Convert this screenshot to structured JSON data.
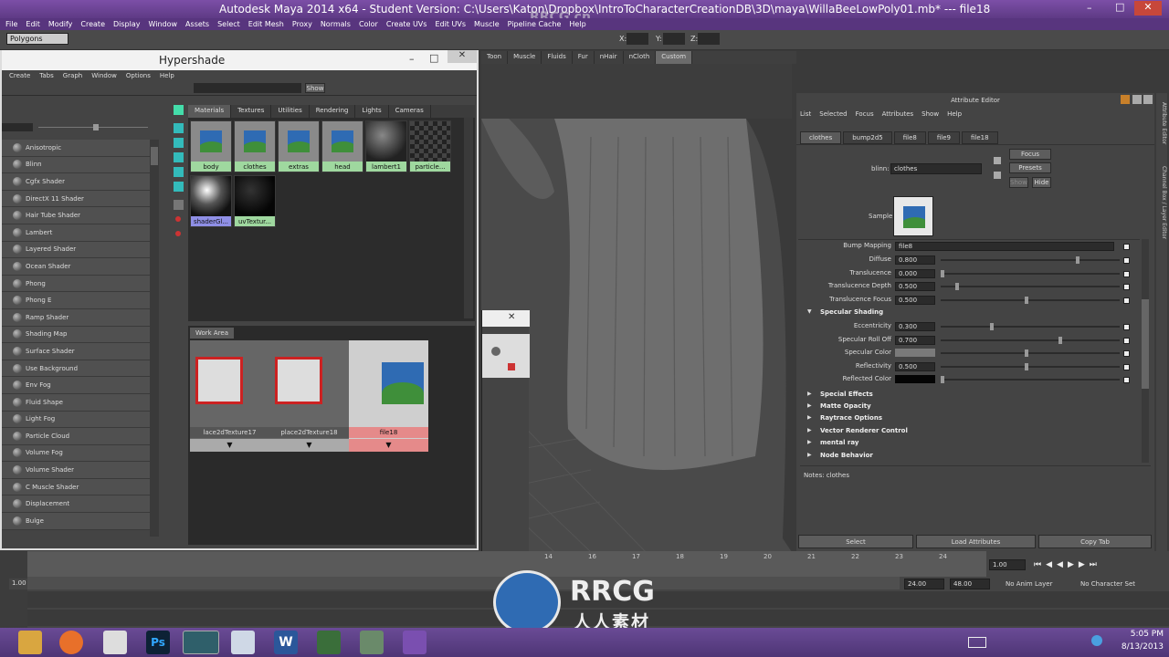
{
  "window": {
    "title": "Autodesk Maya 2014 x64 - Student Version: C:\\Users\\Katon\\Dropbox\\IntroToCharacterCreationDB\\3D\\maya\\WillaBeeLowPoly01.mb* --- file18"
  },
  "menubar": [
    "File",
    "Edit",
    "Modify",
    "Create",
    "Display",
    "Window",
    "Assets",
    "Select",
    "Edit Mesh",
    "Proxy",
    "Normals",
    "Color",
    "Create UVs",
    "Edit UVs",
    "Muscle",
    "Pipeline Cache",
    "Help"
  ],
  "toolbar": {
    "mode": "Polygons",
    "x_label": "X:",
    "y_label": "Y:",
    "z_label": "Z:"
  },
  "shelf_tabs": [
    "Toon",
    "Muscle",
    "Fluids",
    "Fur",
    "nHair",
    "nCloth",
    "Custom"
  ],
  "shelf_active": "Custom",
  "hypershade": {
    "title": "Hypershade",
    "menu": [
      "Create",
      "Tabs",
      "Graph",
      "Window",
      "Options",
      "Help"
    ],
    "show_button": "Show",
    "shaders": [
      "Anisotropic",
      "Blinn",
      "Cgfx Shader",
      "DirectX 11 Shader",
      "Hair Tube Shader",
      "Lambert",
      "Layered Shader",
      "Ocean Shader",
      "Phong",
      "Phong E",
      "Ramp Shader",
      "Shading Map",
      "Surface Shader",
      "Use Background",
      "Env Fog",
      "Fluid Shape",
      "Light Fog",
      "Particle Cloud",
      "Volume Fog",
      "Volume Shader",
      "C Muscle Shader",
      "Displacement",
      "Bulge"
    ],
    "tabs": [
      "Materials",
      "Textures",
      "Utilities",
      "Rendering",
      "Lights",
      "Cameras"
    ],
    "active_tab": "Materials",
    "materials": [
      "body",
      "clothes",
      "extras",
      "head",
      "lambert1",
      "particle...",
      "shaderGl...",
      "uvTextur..."
    ],
    "work_area_label": "Work Area",
    "nodes": [
      "lace2dTexture17",
      "place2dTexture18",
      "file18"
    ]
  },
  "attribute_editor": {
    "title": "Attribute Editor",
    "menu": [
      "List",
      "Selected",
      "Focus",
      "Attributes",
      "Show",
      "Help"
    ],
    "node_tabs": [
      "clothes",
      "bump2d5",
      "file8",
      "file9",
      "file18"
    ],
    "active_node_tab": "clothes",
    "type_label": "blinn:",
    "node_name": "clothes",
    "focus_button": "Focus",
    "presets_button": "Presets",
    "show_button": "Show",
    "hide_button": "Hide",
    "sample_label": "Sample",
    "bump_label": "Bump Mapping",
    "bump_value": "file8",
    "attrs": [
      {
        "label": "Diffuse",
        "value": "0.800"
      },
      {
        "label": "Translucence",
        "value": "0.000"
      },
      {
        "label": "Translucence Depth",
        "value": "0.500"
      },
      {
        "label": "Translucence Focus",
        "value": "0.500"
      }
    ],
    "specular_section": "Specular Shading",
    "specular": [
      {
        "label": "Eccentricity",
        "value": "0.300"
      },
      {
        "label": "Specular Roll Off",
        "value": "0.700"
      },
      {
        "label": "Specular Color",
        "value": ""
      },
      {
        "label": "Reflectivity",
        "value": "0.500"
      },
      {
        "label": "Reflected Color",
        "value": ""
      }
    ],
    "sections": [
      "Special Effects",
      "Matte Opacity",
      "Raytrace Options",
      "Vector Renderer Control",
      "mental ray",
      "Node Behavior"
    ],
    "notes": "Notes: clothes",
    "select_button": "Select",
    "load_button": "Load Attributes",
    "copy_button": "Copy Tab"
  },
  "side_tabs": [
    "Attribute Editor",
    "Channel Box / Layer Editor"
  ],
  "timeline": {
    "ticks": [
      "14",
      "16",
      "17",
      "18",
      "19",
      "20",
      "21",
      "22",
      "23",
      "24"
    ],
    "current_frame": "1.00",
    "range_start": "1.00",
    "end_a": "24.00",
    "end_b": "48.00",
    "anim_layer": "No Anim Layer",
    "char_set": "No Character Set"
  },
  "taskbar": {
    "time": "5:05 PM",
    "date": "8/13/2013"
  },
  "watermark": {
    "brand": "RRCG",
    "sub": "人人素材",
    "top": "RRCG.cn"
  }
}
